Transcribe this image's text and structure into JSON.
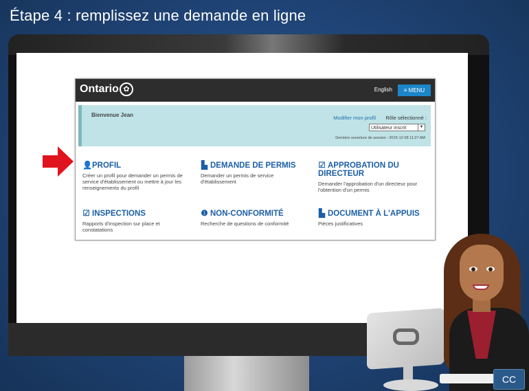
{
  "slide": {
    "title": "Étape 4 : remplissez une demande en ligne",
    "cc_label": "CC"
  },
  "site": {
    "brand": "Ontario",
    "lang_link": "English",
    "menu_label": "≡ MENU",
    "welcome": "Bienvenue Jean",
    "profile_link": "Modifier mon profil",
    "role_label": "Rôle sélectionné :",
    "role_value": "Utilisateur inscrit",
    "last_session": "Dernière ouverture de session : 2015-12-08 11:27 AM",
    "cards": [
      {
        "title": "PROFIL",
        "desc": "Créer un profil pour demander un permis de service d'établissement ou mettre à jour les renseignements du profil",
        "icon": "user-icon"
      },
      {
        "title": "DEMANDE DE PERMIS",
        "desc": "Demander un permis de service d'établissement",
        "icon": "document-icon"
      },
      {
        "title": "APPROBATION DU DIRECTEUR",
        "desc": "Demander l'approbation d'un directeur pour l'obtention d'un permis",
        "icon": "edit-check-icon"
      },
      {
        "title": "INSPECTIONS",
        "desc": "Rapports d'inspection sur place et constatations",
        "icon": "edit-check-icon"
      },
      {
        "title": "NON-CONFORMITÉ",
        "desc": "Recherche de questions de conformité",
        "icon": "alert-icon"
      },
      {
        "title": "DOCUMENT À L'APPUIS",
        "desc": "Pièces justificatives",
        "icon": "document-icon"
      }
    ]
  },
  "colors": {
    "slide_bg": "#1f4375",
    "header_bg": "#2d2d2d",
    "menu_bg": "#1c86c8",
    "welcome_bg": "#bfe3e7",
    "card_title": "#1c5fa6",
    "arrow": "#e0141e"
  }
}
